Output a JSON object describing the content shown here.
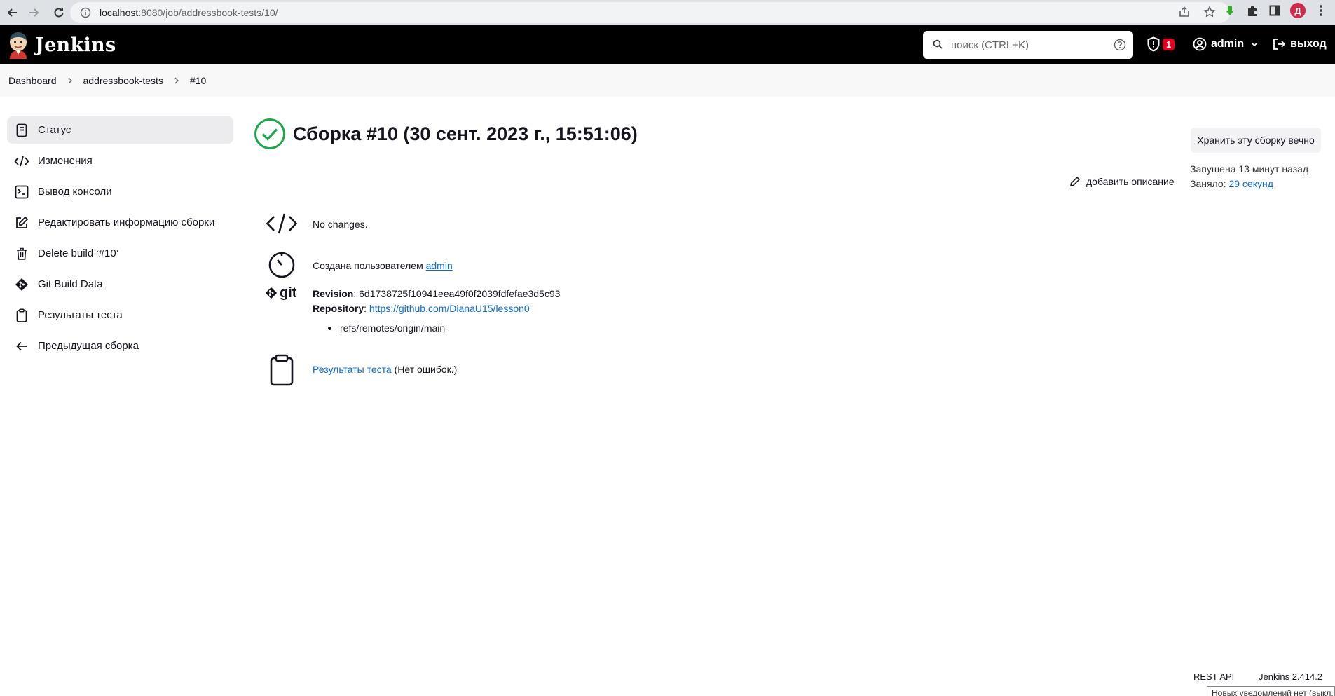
{
  "browser": {
    "url_host": "localhost",
    "url_path": ":8080/job/addressbook-tests/10/",
    "profile_initial": "Д"
  },
  "header": {
    "app_name": "Jenkins",
    "search_placeholder": "поиск (CTRL+K)",
    "security_count": "1",
    "user": "admin",
    "logout": "выход"
  },
  "breadcrumbs": [
    "Dashboard",
    "addressbook-tests",
    "#10"
  ],
  "sidebar": {
    "items": [
      {
        "label": "Статус",
        "icon": "document-icon"
      },
      {
        "label": "Изменения",
        "icon": "code-icon"
      },
      {
        "label": "Вывод консоли",
        "icon": "terminal-icon"
      },
      {
        "label": "Редактировать информацию сборки",
        "icon": "edit-icon"
      },
      {
        "label": "Delete build ‘#10’",
        "icon": "trash-icon"
      },
      {
        "label": "Git Build Data",
        "icon": "git-icon"
      },
      {
        "label": "Результаты теста",
        "icon": "clipboard-icon"
      },
      {
        "label": "Предыдущая сборка",
        "icon": "arrow-left-icon"
      }
    ]
  },
  "main": {
    "title": "Сборка #10 (30 сент. 2023 г., 15:51:06)",
    "keep_button": "Хранить эту сборку вечно",
    "started": "Запущена 13 минут назад",
    "took_label": "Заняло: ",
    "took_value": "29 секунд",
    "add_description": "добавить описание",
    "changes": "No changes.",
    "created_by_label": "Создана пользователем ",
    "created_by_user": "admin",
    "git_logo": "git",
    "revision_label": "Revision",
    "revision_value": ": 6d1738725f10941eea49f0f2039fdfefae3d5c93",
    "repository_label": "Repository",
    "repository_sep": ": ",
    "repository_url": "https://github.com/DianaU15/lesson0",
    "ref": "refs/remotes/origin/main",
    "test_results_link": "Результаты теста",
    "test_results_note": " (Нет ошибок.)"
  },
  "footer": {
    "rest_api": "REST API",
    "version": "Jenkins 2.414.2",
    "tooltip": "Новых уведомлений нет (выкл.)"
  },
  "colors": {
    "success": "#1ea64b",
    "link": "#0b6ad6",
    "badge": "#e6001f"
  }
}
